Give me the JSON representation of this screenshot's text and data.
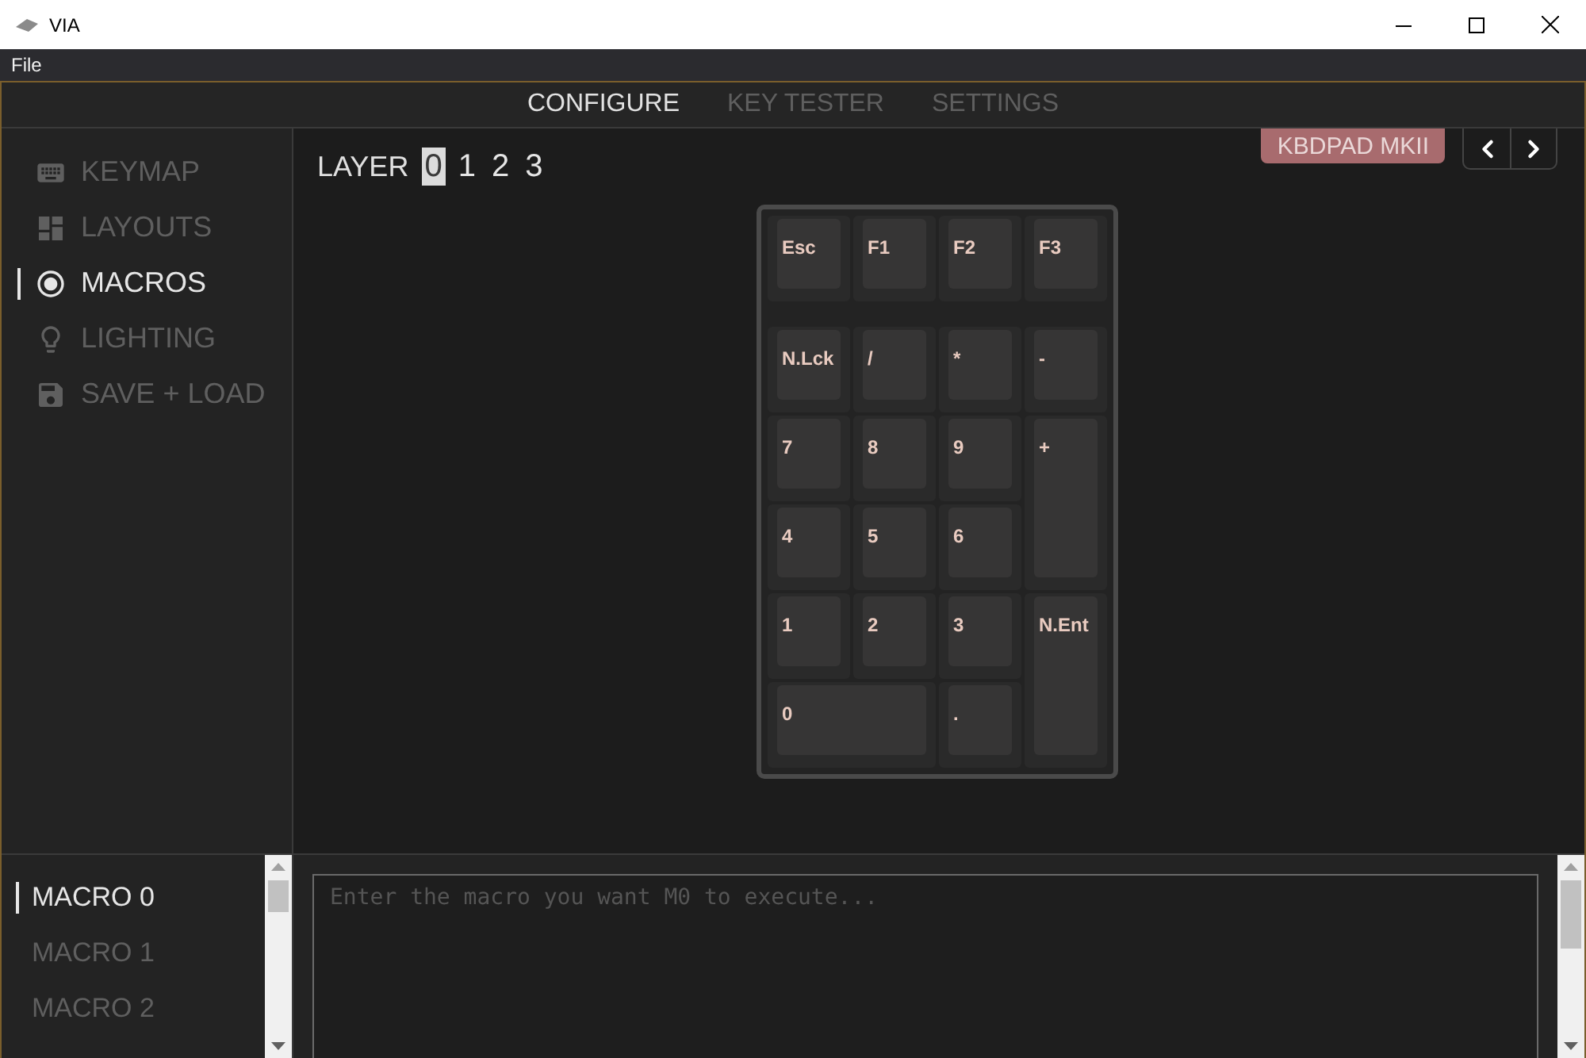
{
  "window": {
    "title": "VIA"
  },
  "menu": [
    "File"
  ],
  "tabs": [
    {
      "label": "CONFIGURE",
      "selected": true
    },
    {
      "label": "KEY TESTER",
      "selected": false
    },
    {
      "label": "SETTINGS",
      "selected": false
    }
  ],
  "sidebar": {
    "items": [
      {
        "label": "KEYMAP",
        "selected": false
      },
      {
        "label": "LAYOUTS",
        "selected": false
      },
      {
        "label": "MACROS",
        "selected": true
      },
      {
        "label": "LIGHTING",
        "selected": false
      },
      {
        "label": "SAVE + LOAD",
        "selected": false
      }
    ]
  },
  "layers": {
    "label": "LAYER",
    "items": [
      {
        "label": "0",
        "selected": true
      },
      {
        "label": "1",
        "selected": false
      },
      {
        "label": "2",
        "selected": false
      },
      {
        "label": "3",
        "selected": false
      }
    ]
  },
  "device": {
    "name": "KBDPAD MKII"
  },
  "keypad": {
    "top_row": [
      {
        "label": "Esc"
      },
      {
        "label": "F1"
      },
      {
        "label": "F2"
      },
      {
        "label": "F3"
      }
    ],
    "keys": [
      {
        "label": "N.Lck",
        "kind": "unit"
      },
      {
        "label": "/",
        "kind": "unit"
      },
      {
        "label": "*",
        "kind": "unit"
      },
      {
        "label": "-",
        "kind": "unit"
      },
      {
        "label": "7",
        "kind": "unit"
      },
      {
        "label": "8",
        "kind": "unit"
      },
      {
        "label": "9",
        "kind": "unit"
      },
      {
        "label": "+",
        "kind": "tall"
      },
      {
        "label": "4",
        "kind": "unit"
      },
      {
        "label": "5",
        "kind": "unit"
      },
      {
        "label": "6",
        "kind": "unit"
      },
      {
        "label": "1",
        "kind": "unit"
      },
      {
        "label": "2",
        "kind": "unit"
      },
      {
        "label": "3",
        "kind": "unit"
      },
      {
        "label": "N.Ent",
        "kind": "tall"
      },
      {
        "label": "0",
        "kind": "wide"
      },
      {
        "label": ".",
        "kind": "unit"
      }
    ]
  },
  "macros": {
    "items": [
      {
        "label": "MACRO 0",
        "selected": true
      },
      {
        "label": "MACRO 1",
        "selected": false
      },
      {
        "label": "MACRO 2",
        "selected": false
      }
    ],
    "editor": {
      "placeholder": "Enter the macro you want M0 to execute..."
    }
  }
}
